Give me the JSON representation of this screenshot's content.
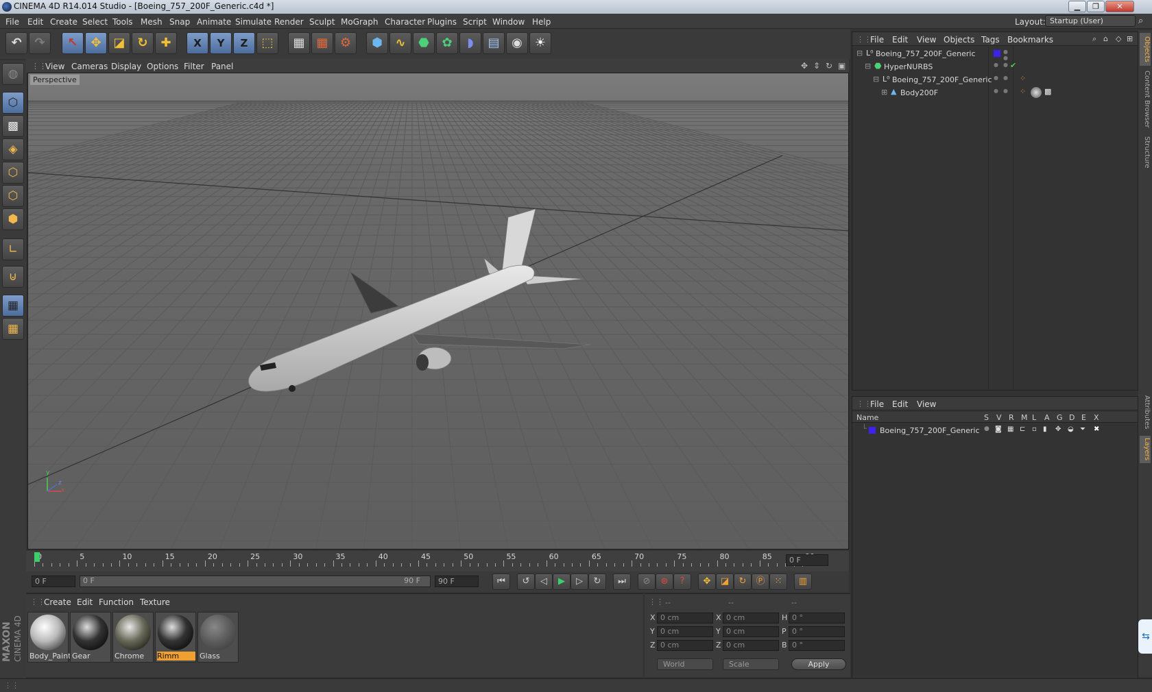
{
  "window": {
    "title": "CINEMA 4D R14.014 Studio - [Boeing_757_200F_Generic.c4d *]",
    "minimize": "▁",
    "restore": "❐",
    "close": "✕"
  },
  "menu": [
    "File",
    "Edit",
    "Create",
    "Select",
    "Tools",
    "Mesh",
    "Snap",
    "Animate",
    "Simulate",
    "Render",
    "Sculpt",
    "MoGraph",
    "Character",
    "Plugins",
    "Script",
    "Window",
    "Help"
  ],
  "layout": {
    "label": "Layout:",
    "value": "Startup (User)"
  },
  "toolbar_icons": [
    "undo-icon",
    "redo-icon",
    "live-selection-icon",
    "move-icon",
    "scale-icon",
    "rotate-icon",
    "add-object-icon",
    "x-axis-icon",
    "y-axis-icon",
    "z-axis-icon",
    "coordinate-system-icon",
    "render-view-icon",
    "render-picture-viewer-icon",
    "render-settings-icon",
    "cube-icon",
    "spline-pen-icon",
    "nurbs-icon",
    "array-icon",
    "deformer-icon",
    "floor-icon",
    "camera-icon",
    "light-icon"
  ],
  "axis_labels": {
    "x": "X",
    "y": "Y",
    "z": "Z"
  },
  "viewport": {
    "menu": [
      "View",
      "Cameras",
      "Display",
      "Options",
      "Filter",
      "Panel"
    ],
    "label": "Perspective",
    "gizmo": {
      "y": "y",
      "x": "x",
      "z": "z"
    }
  },
  "timeline": {
    "ticks": [
      "0",
      "5",
      "10",
      "15",
      "20",
      "25",
      "30",
      "35",
      "40",
      "45",
      "50",
      "55",
      "60",
      "65",
      "70",
      "75",
      "80",
      "85",
      "90"
    ],
    "current": "0 F"
  },
  "transport": {
    "start": "0 F",
    "range_start": "0 F",
    "range_end": "90 F",
    "end": "90 F"
  },
  "materials": {
    "menu": [
      "Create",
      "Edit",
      "Function",
      "Texture"
    ],
    "items": [
      {
        "name": "Body_Paint",
        "selected": false
      },
      {
        "name": "Gear",
        "selected": false
      },
      {
        "name": "Chrome",
        "selected": false
      },
      {
        "name": "Rimm",
        "selected": true
      },
      {
        "name": "Glass",
        "selected": false
      }
    ]
  },
  "coordinates": {
    "headers": [
      "--",
      "--",
      "--"
    ],
    "rows": [
      {
        "a": "X",
        "av": "0 cm",
        "b": "X",
        "bv": "0 cm",
        "c": "H",
        "cv": "0 °"
      },
      {
        "a": "Y",
        "av": "0 cm",
        "b": "Y",
        "bv": "0 cm",
        "c": "P",
        "cv": "0 °"
      },
      {
        "a": "Z",
        "av": "0 cm",
        "b": "Z",
        "bv": "0 cm",
        "c": "B",
        "cv": "0 °"
      }
    ],
    "mode1": "World",
    "mode2": "Scale",
    "apply": "Apply"
  },
  "objects": {
    "menu": [
      "File",
      "Edit",
      "View",
      "Objects",
      "Tags",
      "Bookmarks"
    ],
    "tree": [
      {
        "name": "Boeing_757_200F_Generic",
        "indent": 0
      },
      {
        "name": "HyperNURBS",
        "indent": 1
      },
      {
        "name": "Boeing_757_200F_Generic",
        "indent": 2
      },
      {
        "name": "Body200F",
        "indent": 3
      }
    ],
    "check": "✔"
  },
  "layers": {
    "menu": [
      "File",
      "Edit",
      "View"
    ],
    "columns": [
      "Name",
      "S",
      "V",
      "R",
      "M",
      "L",
      "A",
      "G",
      "D",
      "E",
      "X"
    ],
    "rows": [
      {
        "name": "Boeing_757_200F_Generic"
      }
    ]
  },
  "side_tabs": [
    "Objects",
    "Content Browser",
    "Structure",
    "Attributes",
    "Layers"
  ],
  "brand": {
    "line1": "MAXON",
    "line2": "CINEMA 4D"
  },
  "colors": {
    "accent": "#f0a030",
    "selection": "#6f91c4",
    "layer_color": "#3b22f0"
  }
}
